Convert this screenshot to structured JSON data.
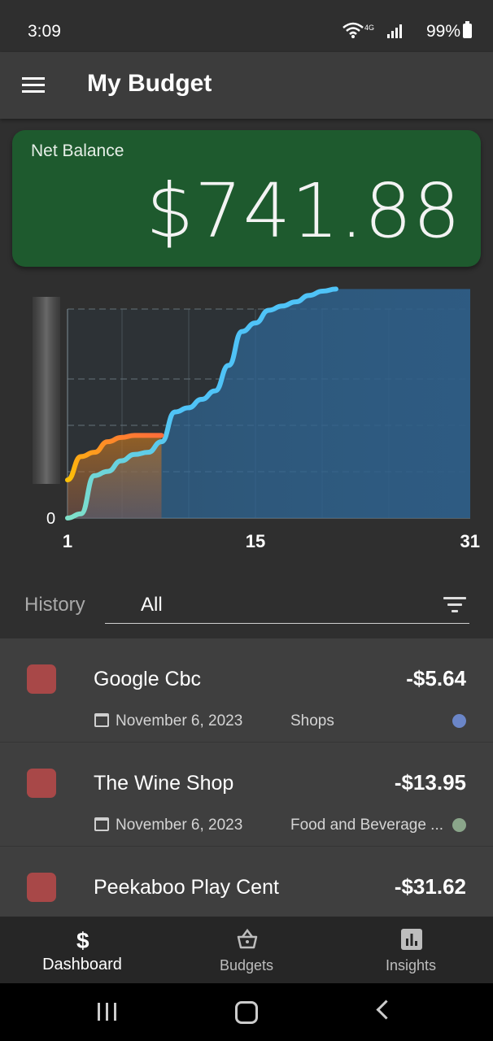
{
  "status_bar": {
    "time": "3:09",
    "battery": "99%",
    "network": "4G"
  },
  "app_bar": {
    "title": "My Budget"
  },
  "balance": {
    "label": "Net Balance",
    "value": "$741.88",
    "color": "#1e5a2e"
  },
  "chart_data": {
    "type": "line",
    "x_ticks": [
      "1",
      "15",
      "31"
    ],
    "y_tick": "0",
    "xlim": [
      1,
      31
    ],
    "grid": true,
    "series": [
      {
        "color": "#4fc3f7",
        "x": [
          1,
          2,
          3,
          4,
          5,
          6,
          7,
          8,
          9,
          10,
          11,
          12,
          13,
          14,
          15,
          16,
          17,
          18,
          19,
          20,
          21
        ],
        "values": [
          0,
          2,
          20,
          22,
          27,
          30,
          31,
          36,
          50,
          52,
          56,
          60,
          72,
          88,
          92,
          98,
          100,
          102,
          105,
          107,
          108
        ]
      },
      {
        "color": "#ff9800",
        "x": [
          1,
          2,
          3,
          4,
          5,
          6,
          7,
          8
        ],
        "values": [
          18,
          29,
          31,
          36,
          38,
          39,
          39,
          39
        ]
      }
    ]
  },
  "history": {
    "label": "History",
    "filter_value": "All"
  },
  "transactions": [
    {
      "name": "Google Cbc",
      "amount": "-$5.64",
      "date": "November 6, 2023",
      "category": "Shops",
      "category_color": "#6b86c8"
    },
    {
      "name": "The Wine Shop",
      "amount": "-$13.95",
      "date": "November 6, 2023",
      "category": "Food and Beverage ...",
      "category_color": "#8aa58a"
    },
    {
      "name": "Peekaboo Play Cent",
      "amount": "-$31.62",
      "date": "",
      "category": "",
      "category_color": ""
    }
  ],
  "bottom_nav": {
    "items": [
      {
        "label": "Dashboard",
        "icon": "dollar-icon"
      },
      {
        "label": "Budgets",
        "icon": "basket-icon"
      },
      {
        "label": "Insights",
        "icon": "bar-chart-icon"
      }
    ]
  }
}
